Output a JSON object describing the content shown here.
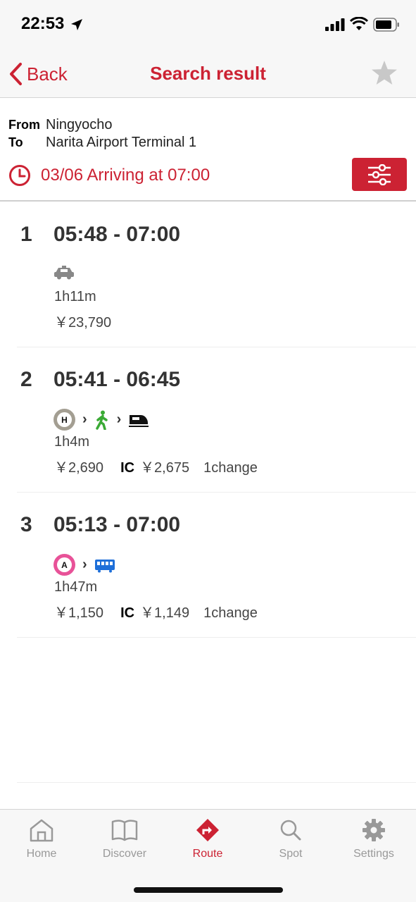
{
  "status_bar": {
    "time": "22:53"
  },
  "nav": {
    "back_label": "Back",
    "title": "Search result"
  },
  "conditions": {
    "from_label": "From",
    "from_value": "Ningyocho",
    "to_label": "To",
    "to_value": "Narita Airport Terminal 1",
    "arrival_text": "03/06 Arriving at 07:00"
  },
  "routes": [
    {
      "index": "1",
      "time_span": "05:48 - 07:00",
      "duration": "1h11m",
      "fare": "￥23,790"
    },
    {
      "index": "2",
      "time_span": "05:41 - 06:45",
      "duration": "1h4m",
      "fare": "￥2,690",
      "ic_label": "IC",
      "ic_fare": "￥2,675",
      "changes": "1change",
      "line_badge": "H"
    },
    {
      "index": "3",
      "time_span": "05:13 - 07:00",
      "duration": "1h47m",
      "fare": "￥1,150",
      "ic_label": "IC",
      "ic_fare": "￥1,149",
      "changes": "1change",
      "line_badge": "A"
    }
  ],
  "tabs": [
    {
      "label": "Home",
      "icon": "home-icon"
    },
    {
      "label": "Discover",
      "icon": "book-icon"
    },
    {
      "label": "Route",
      "icon": "route-icon",
      "active": true
    },
    {
      "label": "Spot",
      "icon": "search-icon"
    },
    {
      "label": "Settings",
      "icon": "gear-icon"
    }
  ],
  "colors": {
    "accent": "#cc2233",
    "inactive": "#999999",
    "walk": "#3aaa35",
    "rail": "#1e6fd9",
    "line_h_badge": "#a39e92",
    "line_a_badge": "#e85298"
  }
}
